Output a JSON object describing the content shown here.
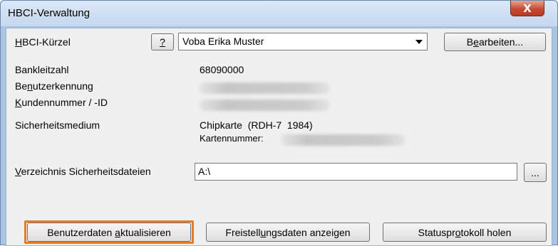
{
  "window": {
    "title": "HBCI-Verwaltung",
    "close_glyph": "X"
  },
  "hbci_kuerzel": {
    "label_prefix": "",
    "label_accel": "H",
    "label_rest": "BCI-Kürzel",
    "help_label": "?",
    "selected": "Voba Erika Muster",
    "edit_prefix": "B",
    "edit_accel": "e",
    "edit_rest": "arbeiten..."
  },
  "fields": {
    "bankleitzahl_label": "Bankleitzahl",
    "bankleitzahl_value": "68090000",
    "benutzer_pre": "Be",
    "benutzer_accel": "n",
    "benutzer_rest": "utzerkennung",
    "kunden_accel": "K",
    "kunden_rest": "undennummer / -ID",
    "sicherheit_label": "Sicherheitsmedium",
    "sicherheit_value": "Chipkarte  (RDH-7  1984)",
    "kartennummer_label": "Kartennummer:"
  },
  "verzeichnis": {
    "label_accel": "V",
    "label_rest": "erzeichnis Sicherheitsdateien",
    "value": "A:\\",
    "browse_label": "..."
  },
  "buttons": {
    "aktualisieren_pre": "Benutzerdaten ",
    "aktualisieren_accel": "a",
    "aktualisieren_rest": "ktualisieren",
    "freistellung_pre": "Freistell",
    "freistellung_accel": "u",
    "freistellung_rest": "ngsdaten anzeigen",
    "status_pre": "Statuspr",
    "status_accel": "o",
    "status_rest": "tokoll holen"
  },
  "colors": {
    "highlight": "#ea7b1e",
    "close_button": "#c84a35"
  }
}
